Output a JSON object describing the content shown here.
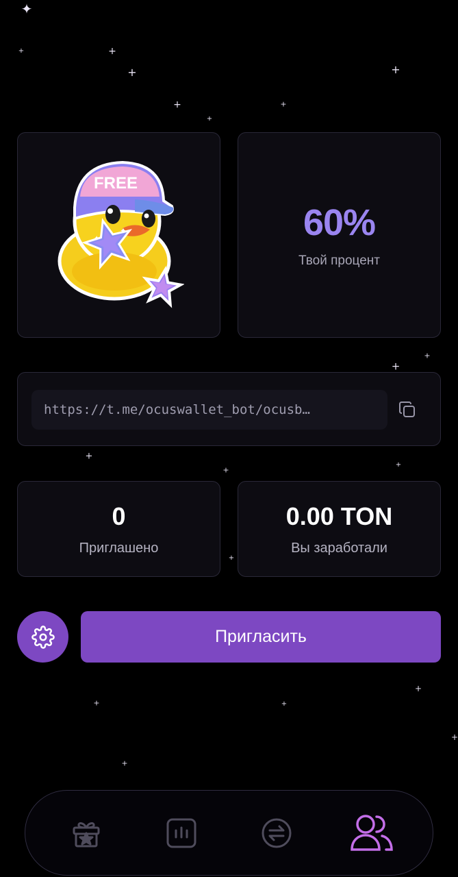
{
  "sticker": {
    "icon": "duck-free-cap-sticker",
    "cap_text": "FREE"
  },
  "referral": {
    "percent_value": "60%",
    "percent_label": "Твой процент",
    "link_display": "https://t.me/ocuswallet_bot/ocusb…",
    "copy_icon": "copy-icon"
  },
  "stats": {
    "invited_value": "0",
    "invited_label": "Приглашено",
    "earned_value": "0.00 TON",
    "earned_label": "Вы заработали"
  },
  "actions": {
    "settings_icon": "gear-icon",
    "invite_label": "Пригласить"
  },
  "nav": {
    "items": [
      {
        "icon": "gift-star-icon",
        "active": false
      },
      {
        "icon": "chart-icon",
        "active": false
      },
      {
        "icon": "swap-icon",
        "active": false
      },
      {
        "icon": "users-icon",
        "active": true
      }
    ]
  },
  "colors": {
    "background": "#000000",
    "card": "#0d0c12",
    "card_border": "#2a2838",
    "accent": "#7d48c2",
    "percent": "#9a85f0",
    "nav_active": "#c36ee8",
    "nav_inactive": "#4f4c5c"
  }
}
